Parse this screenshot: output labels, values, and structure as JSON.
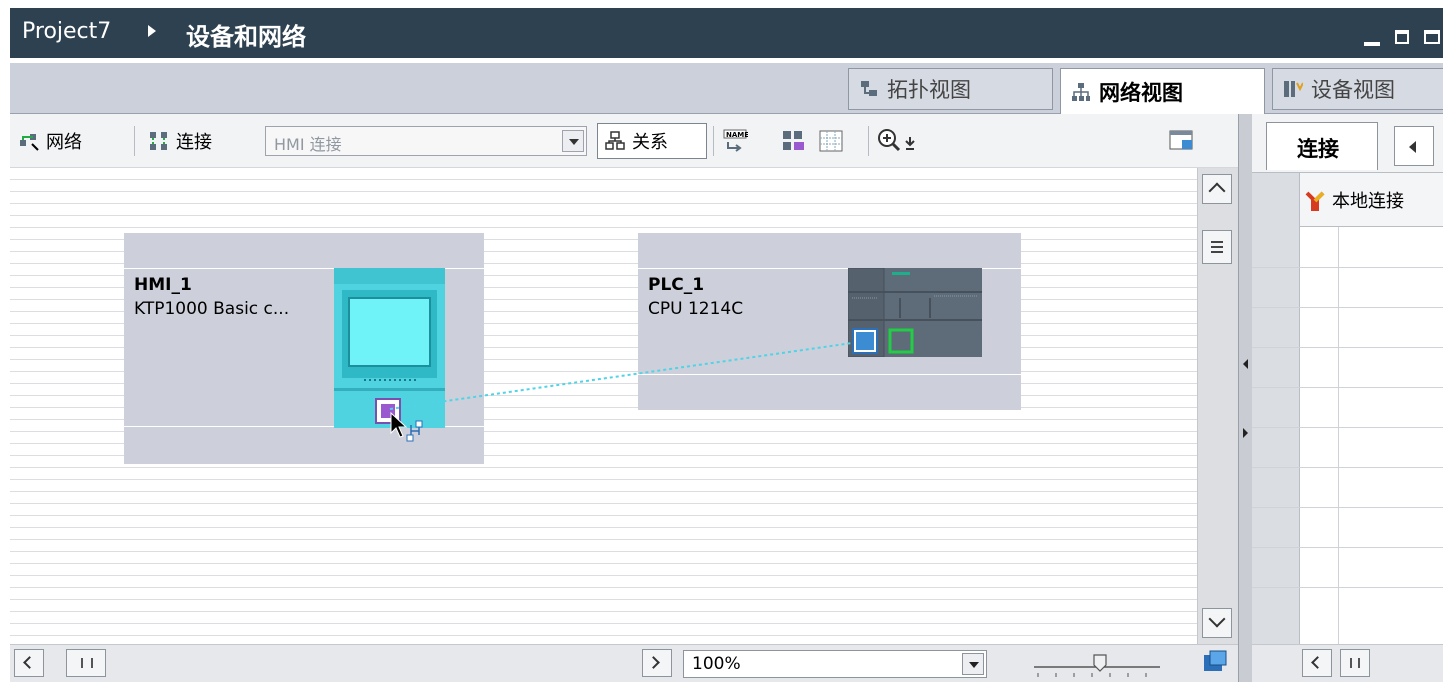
{
  "titlebar": {
    "project": "Project7",
    "page": "设备和网络"
  },
  "view_tabs": {
    "topology": "拓扑视图",
    "network": "网络视图",
    "device": "设备视图",
    "active": "network"
  },
  "toolbar": {
    "network_label": "网络",
    "connections_label": "连接",
    "connection_type": "HMI 连接",
    "relations_label": "关系",
    "icons": [
      "network-icon",
      "connections-icon",
      "relations-icon",
      "name-icon",
      "show-address-icon",
      "grid-icon",
      "zoom-icon",
      "save-layout-icon"
    ]
  },
  "devices": [
    {
      "name": "HMI_1",
      "type": "KTP1000 Basic c...",
      "icon": "hmi-panel-icon"
    },
    {
      "name": "PLC_1",
      "type": "CPU 1214C",
      "icon": "plc-cpu-icon"
    }
  ],
  "connection_line": {
    "style": "dotted",
    "color": "#4fd3e6"
  },
  "bottom": {
    "zoom": "100%"
  },
  "right_panel": {
    "tab_label": "连接",
    "column_header": "本地连接",
    "column_icon": "local-connection-icon"
  },
  "colors": {
    "title_bar": "#2d4150",
    "device_box": "#cdd0da",
    "hmi": "#4fd3e0",
    "plc": "#5e6b78",
    "port_purple": "#9b59d0",
    "port_green": "#22cc44"
  }
}
